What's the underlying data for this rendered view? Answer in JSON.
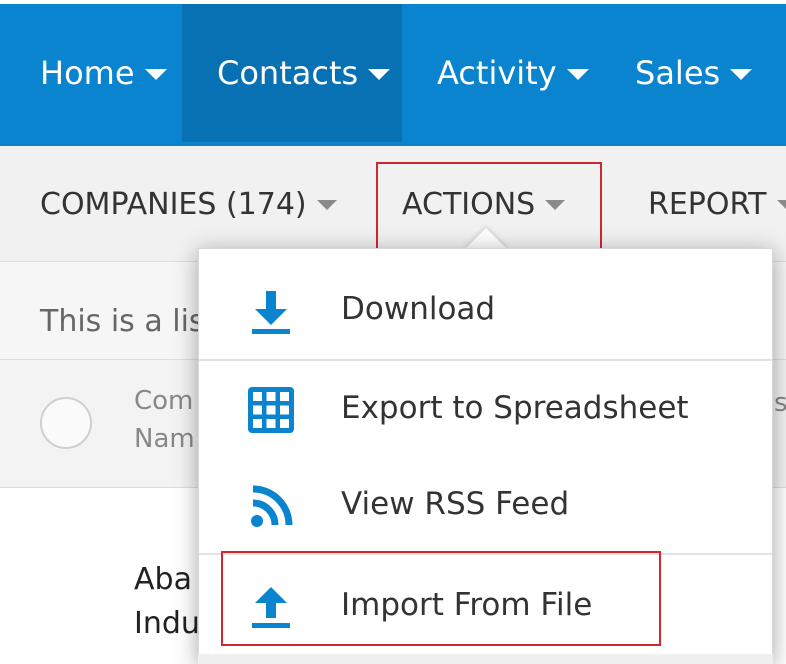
{
  "nav": {
    "items": [
      {
        "label": "Home"
      },
      {
        "label": "Contacts"
      },
      {
        "label": "Activity"
      },
      {
        "label": "Sales"
      }
    ],
    "active_index": 1
  },
  "subnav": {
    "companies_label": "COMPANIES (174)",
    "actions_label": "ACTIONS",
    "report_label": "REPORT"
  },
  "description": {
    "text": "This is a lis"
  },
  "table": {
    "header": {
      "column_line1": "Com",
      "column_line2": "Nam",
      "right_fragment": "s"
    },
    "rows": [
      {
        "line1": "Aba",
        "line2": "Indu"
      }
    ]
  },
  "actions_menu": {
    "items": [
      {
        "label": "Download",
        "icon": "download-icon"
      },
      {
        "label": "Export to Spreadsheet",
        "icon": "grid-icon"
      },
      {
        "label": "View RSS Feed",
        "icon": "rss-icon"
      },
      {
        "label": "Import From File",
        "icon": "upload-icon"
      }
    ]
  },
  "colors": {
    "primary": "#0a84cf",
    "primary_active": "#0771b3",
    "icon_blue": "#0a84cf",
    "highlight_red": "#d22630"
  }
}
